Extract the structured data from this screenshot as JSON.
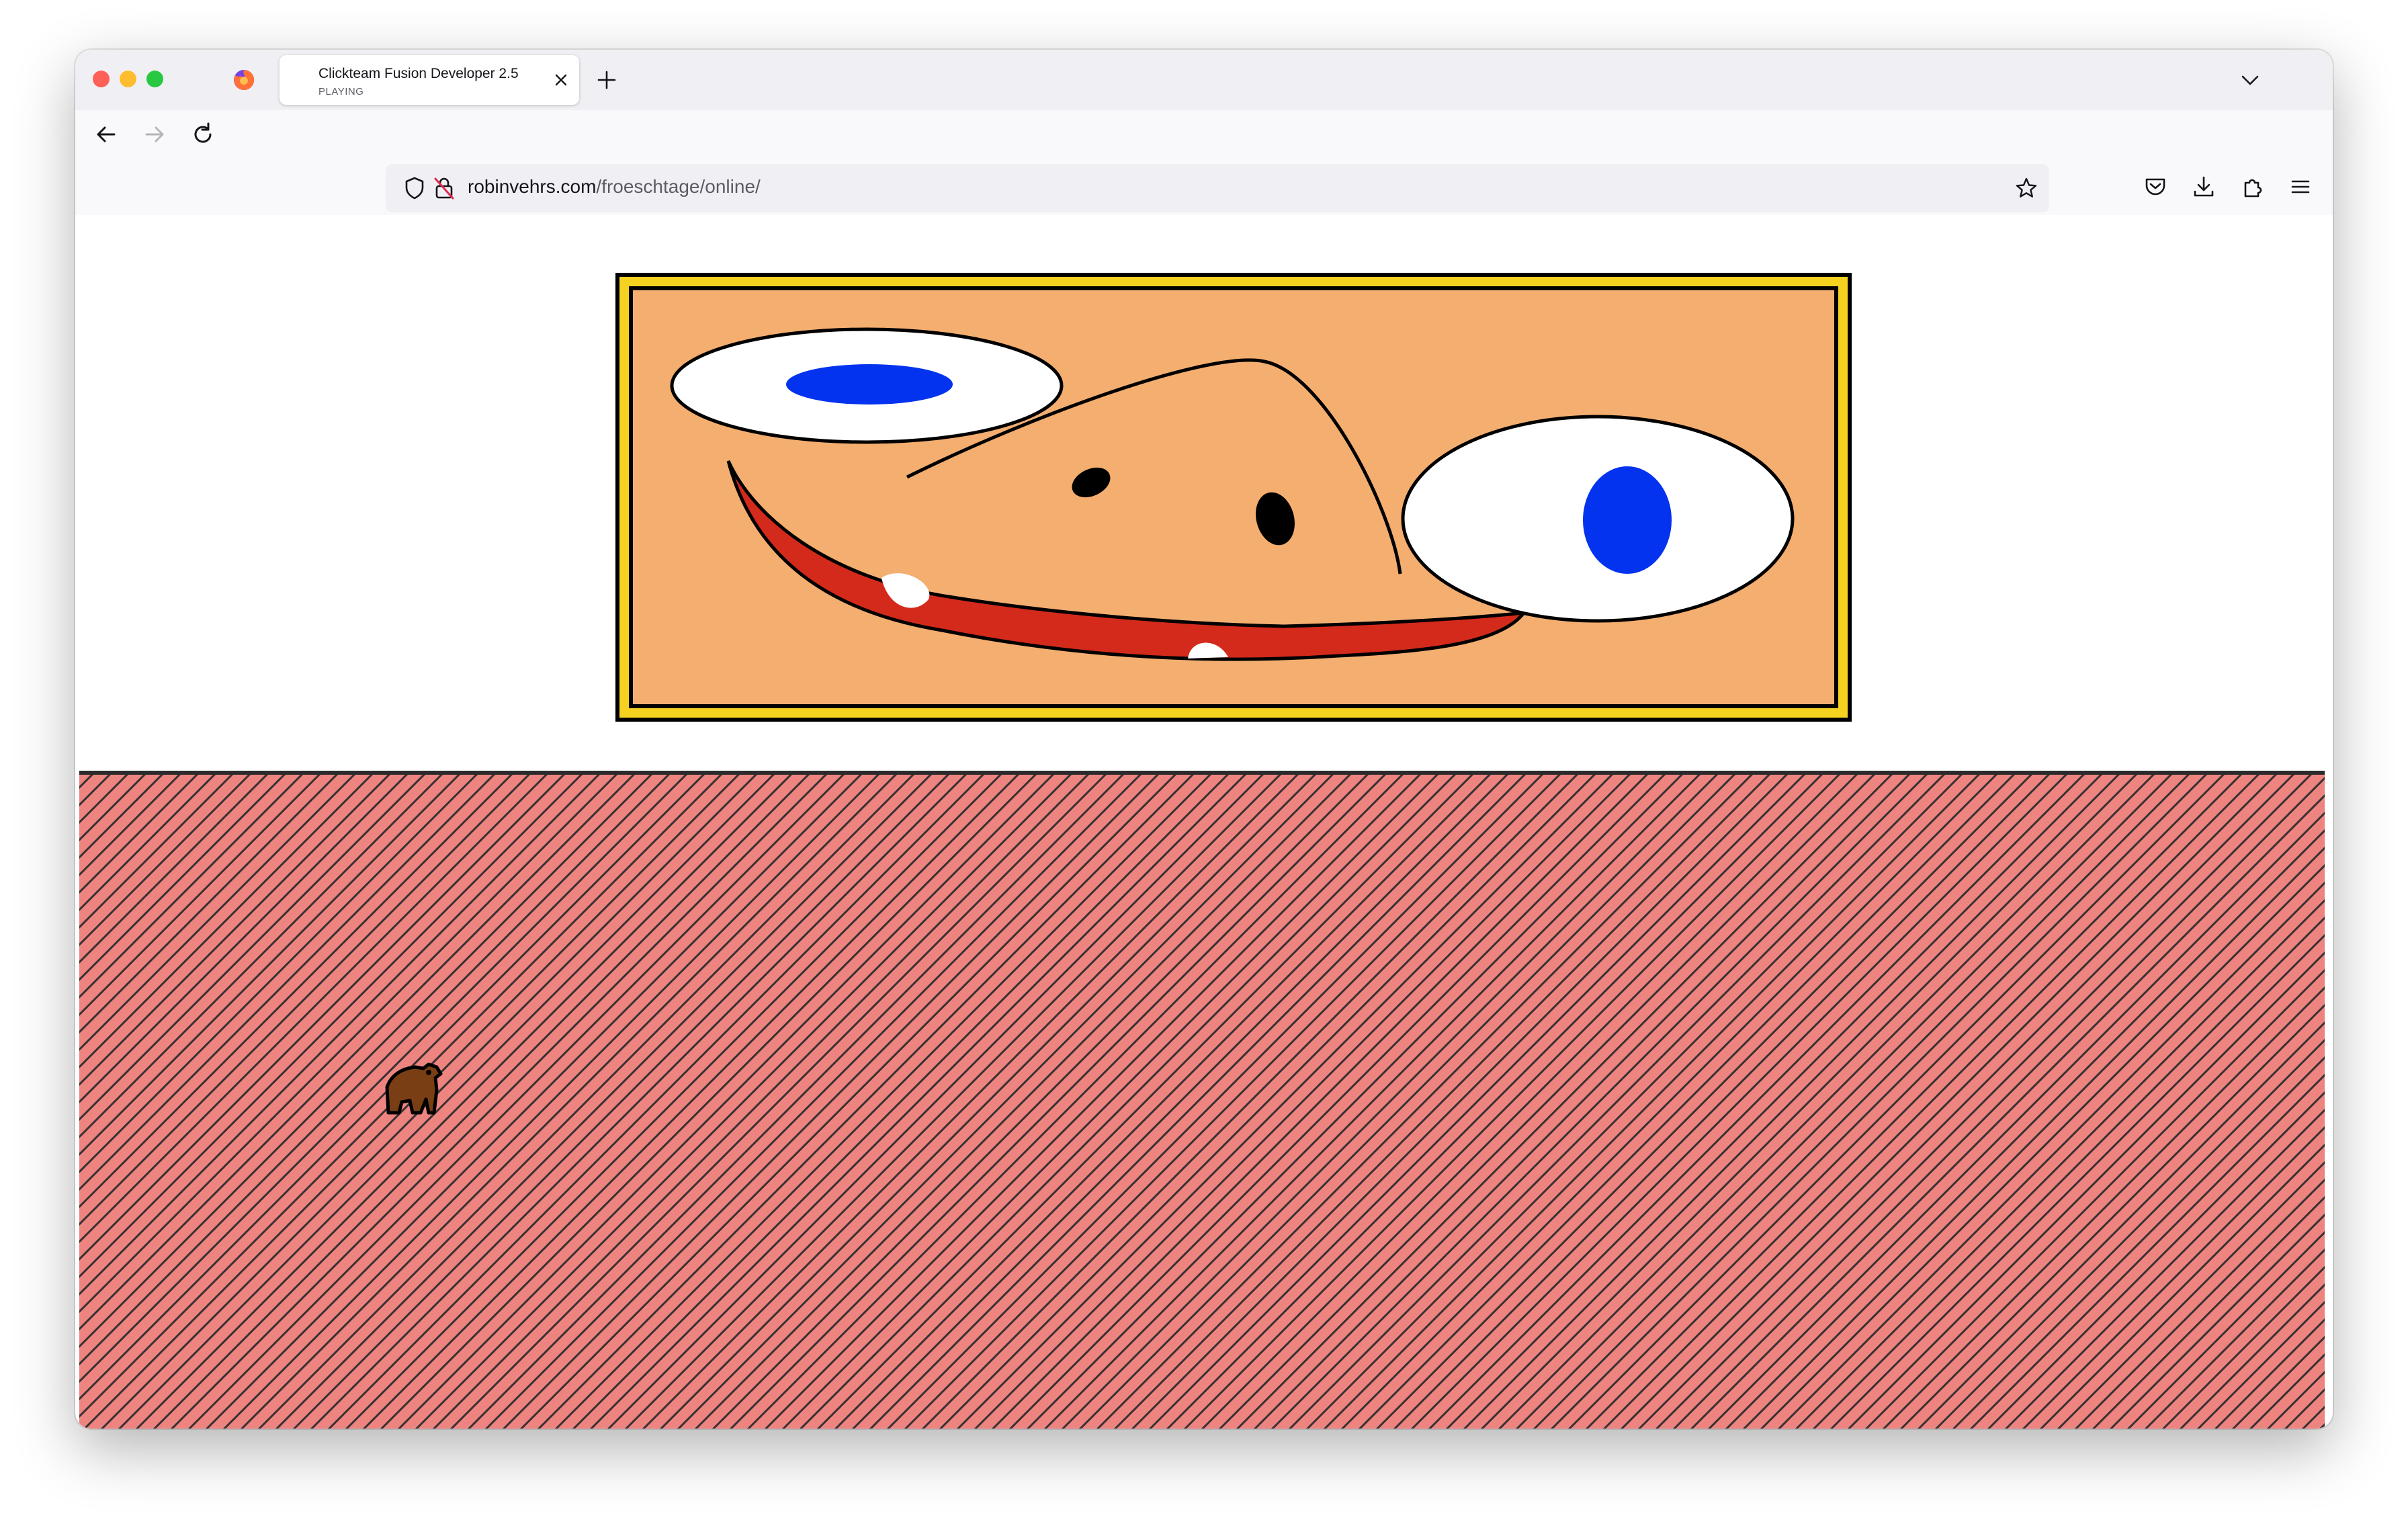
{
  "browser": {
    "tab": {
      "title": "Clickteam Fusion Developer 2.5",
      "subtitle": "PLAYING",
      "favicon": "page-icon"
    },
    "url": {
      "domain": "robinvehrs.com",
      "path": "/froeschtage/online/"
    },
    "icons": {
      "firefox": "firefox-icon",
      "back": "back-arrow-icon",
      "forward": "forward-arrow-icon",
      "reload": "reload-icon",
      "shield": "tracking-protection-shield-icon",
      "insecure": "insecure-connection-icon",
      "bookmark": "bookmark-star-icon",
      "pocket": "pocket-icon",
      "download": "download-icon",
      "extensions": "extensions-icon",
      "menu": "hamburger-menu-icon",
      "newtab": "plus-icon",
      "tablist": "chevron-down-icon",
      "close": "close-icon"
    }
  },
  "game": {
    "colors": {
      "banner_frame": "#f4d21f",
      "banner_background": "#f4ae70",
      "eye_white": "#ffffff",
      "pupil": "#0433ef",
      "mouth": "#d42a1c",
      "floor": "#ee8480",
      "floor_stripes": "#3a3032",
      "character": "#7a3e14"
    }
  }
}
